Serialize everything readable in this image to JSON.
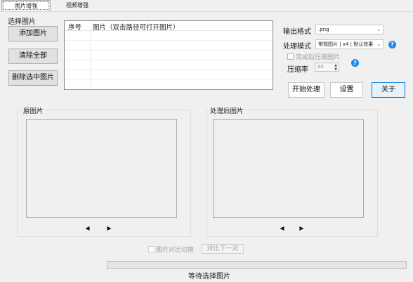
{
  "tabs": {
    "image_tab": "图片增强",
    "video_tab": "视频增强"
  },
  "select_section": {
    "title": "选择图片",
    "add_button": "添加图片",
    "clear_button": "清除全部",
    "remove_button": "删除选中图片"
  },
  "file_list": {
    "col_index": "序号",
    "col_image": "图片（双击路径可打开图片）"
  },
  "options": {
    "output_format_label": "输出格式",
    "output_format_value": ".png",
    "mode_label": "处理模式",
    "mode_value": "常规图片 | x4 | 默认效果",
    "compress_after_label": "完成后压缩图片",
    "compress_ratio_label": "压缩率",
    "compress_ratio_value": "80",
    "help_icon_text": "?"
  },
  "actions": {
    "start_button": "开始处理",
    "settings_button": "设置",
    "about_button": "关于"
  },
  "preview": {
    "original_title": "原图片",
    "processed_title": "处理后图片",
    "prev_glyph": "◀",
    "next_glyph": "▶"
  },
  "compare": {
    "toggle_label": "图片对比切换",
    "next_pair_button": "对比下一对"
  },
  "status": {
    "text": "等待选择图片"
  },
  "colors": {
    "help_icon": "#1e88e5",
    "accent_border": "#0078d7",
    "background": "#f0f0f0"
  }
}
